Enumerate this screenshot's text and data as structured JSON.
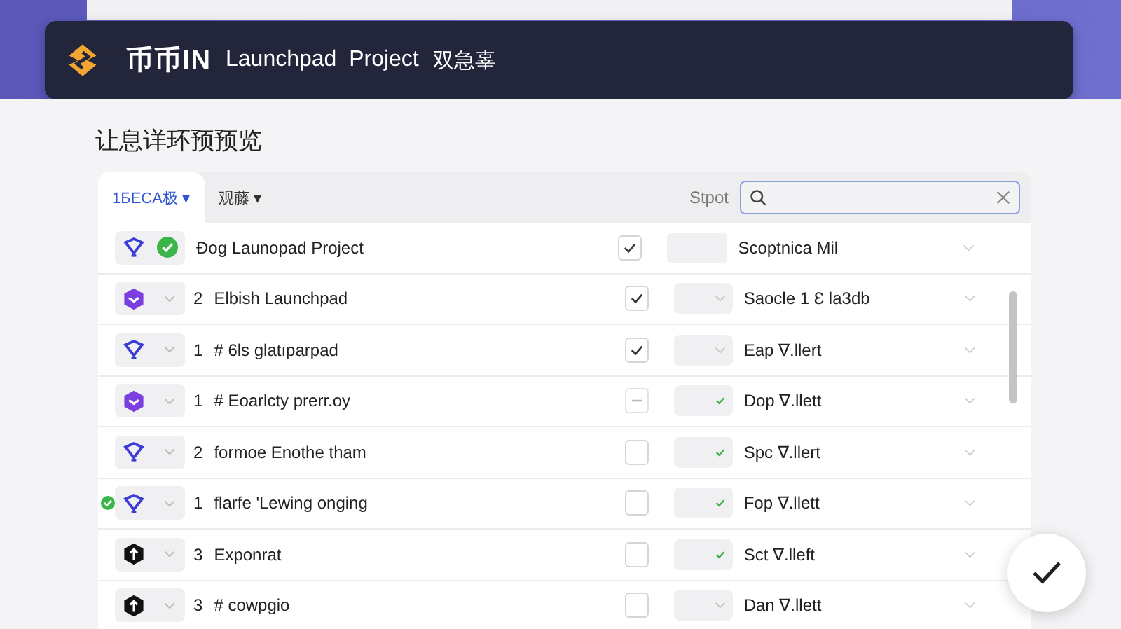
{
  "header": {
    "brand": "币币IN",
    "title": "Launchpad  Project",
    "subtitle": "双急辜"
  },
  "page_title": "让息详环预预览",
  "tabs": [
    {
      "label": "1БECA极 ▾",
      "selected": true
    },
    {
      "label": "观藤 ▾",
      "selected": false
    }
  ],
  "search": {
    "label": "Stpot"
  },
  "rows": [
    {
      "kind": "funnel",
      "status_dot": false,
      "verified": true,
      "number": "",
      "name": "Đog Launopad Project",
      "checked": true,
      "indeterminate": false,
      "select_ok": null,
      "value": "Scoptnica Mil"
    },
    {
      "kind": "hexagon",
      "status_dot": false,
      "verified": false,
      "number": "2",
      "name": "Elbish Launchpad",
      "checked": true,
      "indeterminate": false,
      "select_ok": false,
      "value": "Saocle 1 Ɛ la3db"
    },
    {
      "kind": "funnel",
      "status_dot": false,
      "verified": false,
      "number": "1",
      "name": "# 6ls glatıparpad",
      "checked": true,
      "indeterminate": false,
      "select_ok": false,
      "value": "Eap ∇.llert"
    },
    {
      "kind": "hexagon",
      "status_dot": false,
      "verified": false,
      "number": "1",
      "name": "# Eoarlcty prerr.oy",
      "checked": false,
      "indeterminate": true,
      "select_ok": true,
      "value": "Dop ∇.llett"
    },
    {
      "kind": "funnel",
      "status_dot": false,
      "verified": false,
      "number": "2",
      "name": "formoe Enothe tham",
      "checked": false,
      "indeterminate": false,
      "select_ok": true,
      "value": "Spc ∇.llert"
    },
    {
      "kind": "funnel",
      "status_dot": true,
      "verified": false,
      "number": "1",
      "name": "flarfe 'Lewing onging",
      "checked": false,
      "indeterminate": false,
      "select_ok": true,
      "value": "Fop ∇.llett"
    },
    {
      "kind": "arrow",
      "status_dot": false,
      "verified": false,
      "number": "3",
      "name": "Exponrat",
      "checked": false,
      "indeterminate": false,
      "select_ok": true,
      "value": "Sct ∇.lleft"
    },
    {
      "kind": "arrow",
      "status_dot": false,
      "verified": false,
      "number": "3",
      "name": "# cowpgio",
      "checked": false,
      "indeterminate": false,
      "select_ok": false,
      "value": "Dan ∇.llett"
    }
  ]
}
